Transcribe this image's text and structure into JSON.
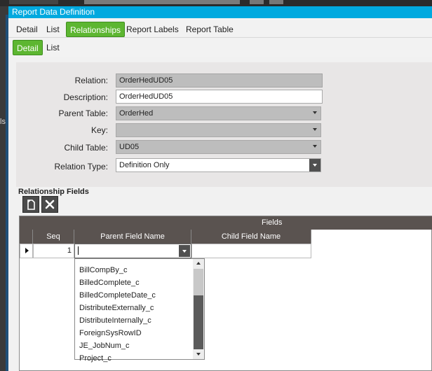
{
  "window": {
    "title": "Report Data Definition"
  },
  "tabs_primary": [
    {
      "label": "Detail",
      "active": false
    },
    {
      "label": "List",
      "active": false
    },
    {
      "label": "Relationships",
      "active": true
    },
    {
      "label": "Report Labels",
      "active": false
    },
    {
      "label": "Report Table",
      "active": false
    }
  ],
  "tabs_secondary": [
    {
      "label": "Detail",
      "active": true
    },
    {
      "label": "List",
      "active": false
    }
  ],
  "form": {
    "relation": {
      "label": "Relation:",
      "value": "OrderHedUD05"
    },
    "description": {
      "label": "Description:",
      "value": "OrderHedUD05"
    },
    "parent_table": {
      "label": "Parent Table:",
      "value": "OrderHed"
    },
    "key": {
      "label": "Key:",
      "value": ""
    },
    "child_table": {
      "label": "Child Table:",
      "value": "UD05"
    },
    "relation_type": {
      "label": "Relation Type:",
      "value": "Definition Only"
    }
  },
  "relationship_fields": {
    "title": "Relationship Fields",
    "toolbar": [
      {
        "icon": "new-icon"
      },
      {
        "icon": "delete-icon"
      }
    ],
    "band_label": "Fields",
    "columns": [
      "Seq",
      "Parent Field Name",
      "Child Field Name"
    ],
    "rows": [
      {
        "seq": "1",
        "parent_field": "",
        "child_field": ""
      }
    ],
    "dropdown_options": [
      "BillCompBy_c",
      "BilledComplete_c",
      "BilledCompleteDate_c",
      "DistributeExternally_c",
      "DistributeInternally_c",
      "ForeignSysRowID",
      "JE_JobNum_c",
      "Project_c"
    ]
  },
  "colors": {
    "titlebar": "#01a9df",
    "active_tab": "#5db631",
    "grid_header": "#5a5350"
  }
}
